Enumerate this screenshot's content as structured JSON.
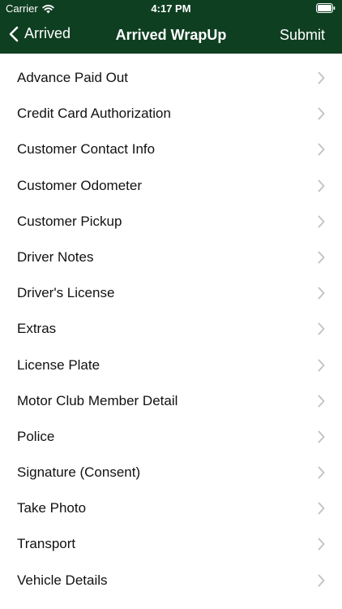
{
  "status_bar": {
    "carrier": "Carrier",
    "time": "4:17 PM"
  },
  "navbar": {
    "back_label": "Arrived",
    "title": "Arrived WrapUp",
    "submit_label": "Submit",
    "background_color": "#0f3f21"
  },
  "menu": {
    "items": [
      "Advance Paid Out",
      "Credit Card Authorization",
      "Customer Contact Info",
      "Customer Odometer",
      "Customer Pickup",
      "Driver Notes",
      "Driver's License",
      "Extras",
      "License Plate",
      "Motor Club Member Detail",
      "Police",
      "Signature (Consent)",
      "Take Photo",
      "Transport",
      "Vehicle Details"
    ]
  }
}
